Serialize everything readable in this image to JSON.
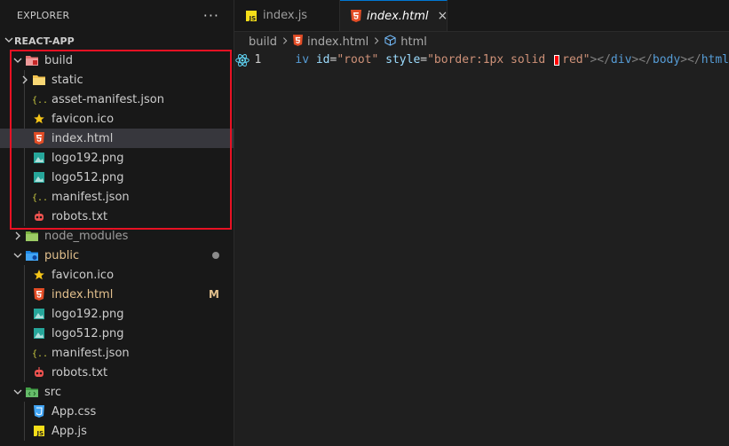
{
  "sidebar": {
    "title": "EXPLORER",
    "more": "···",
    "project": "REACT-APP",
    "build": {
      "label": "build",
      "items": [
        "static",
        "asset-manifest.json",
        "favicon.ico",
        "index.html",
        "logo192.png",
        "logo512.png",
        "manifest.json",
        "robots.txt"
      ]
    },
    "node_modules": "node_modules",
    "public": {
      "label": "public",
      "items": [
        "favicon.ico",
        "index.html",
        "logo192.png",
        "logo512.png",
        "manifest.json",
        "robots.txt"
      ],
      "modified_badge": "M"
    },
    "src": {
      "label": "src",
      "items": [
        "App.css",
        "App.js"
      ]
    }
  },
  "tabs": [
    {
      "label": "index.js"
    },
    {
      "label": "index.html",
      "close": "×"
    }
  ],
  "breadcrumbs": [
    "build",
    "index.html",
    "html"
  ],
  "editor": {
    "line_number": "1",
    "code": {
      "t1": "iv ",
      "t2": "id",
      "t3": "=",
      "t4": "\"root\"",
      "t5": " ",
      "t6": "style",
      "t7": "=",
      "t8": "\"border:1px solid ",
      "t9": "red\"",
      "t10": "></",
      "t11": "div",
      "t12": "></",
      "t13": "body",
      "t14": "></",
      "t15": "html"
    }
  },
  "colors": {
    "accent": "#0078d4",
    "highlight_box": "#e81123",
    "color_swatch": "#ff0000"
  }
}
